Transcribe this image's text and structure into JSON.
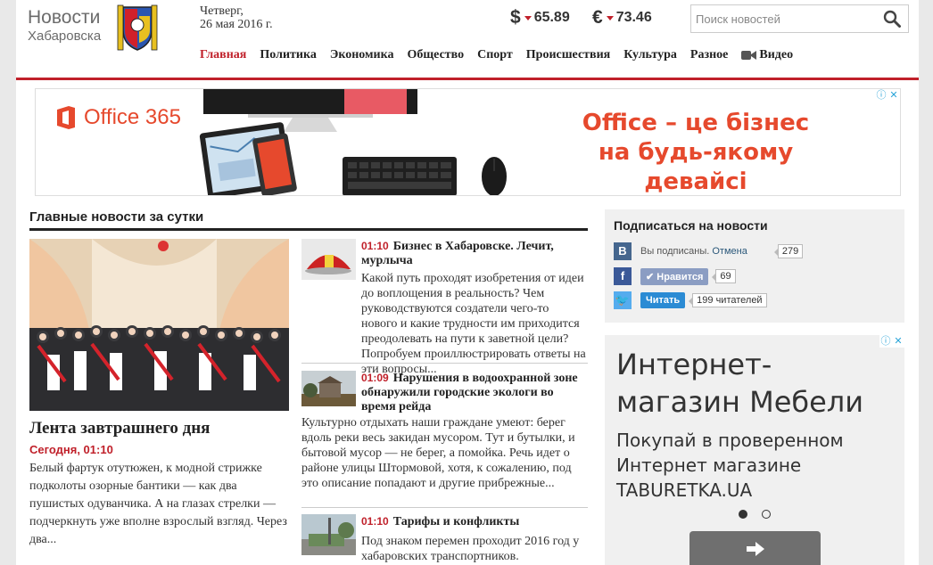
{
  "site": {
    "logo_line1": "Новости",
    "logo_line2": "Хабаровска",
    "date_line1": "Четверг,",
    "date_line2": "26 мая 2016 г."
  },
  "rates": {
    "usd_symbol": "$",
    "usd_value": "65.89",
    "eur_symbol": "€",
    "eur_value": "73.46",
    "trend_color": "#c0202a"
  },
  "search": {
    "placeholder": "Поиск новостей",
    "value": ""
  },
  "nav": {
    "items": [
      "Главная",
      "Политика",
      "Экономика",
      "Общество",
      "Спорт",
      "Происшествия",
      "Культура",
      "Разное",
      "Видео"
    ],
    "active_index": 0
  },
  "ad_top": {
    "brand": "Office 365",
    "slogan_line1": "Office – це бізнес",
    "slogan_line2": "на будь-якому девайсі"
  },
  "main": {
    "section_title": "Главные новости за сутки",
    "title": "Лента завтрашнего дня",
    "time": "Сегодня, 01:10",
    "lead": "Белый фартук отутюжен, к модной стрижке подколоты озорные бантики — как два пушистых одуванчика. А на глазах стрелки — подчеркнуть уже вполне взрослый взгляд. Через два..."
  },
  "news": [
    {
      "time": "01:10",
      "title": "Бизнес в Хабаровске. Лечит, мурлыча",
      "text": "Какой путь проходят изобретения от идеи до воплощения в реальность? Чем руководствуются создатели чего-то нового и какие трудности им приходится преодолевать на пути к заветной цели? Попробуем проиллюстрировать ответы на эти вопросы..."
    },
    {
      "time": "01:09",
      "title": "Нарушения в водоохранной зоне обнаружили городские экологи во время рейда",
      "text": "Культурно отдыхать наши граждане умеют: берег вдоль реки весь закидан мусором.  Тут и бутылки, и бытовой мусор — не берег, а помойка. Речь идет о районе улицы Штормовой, хотя, к сожалению, под это описание попадают и другие прибрежные..."
    },
    {
      "time": "01:10",
      "title": "Тарифы и конфликты",
      "text": "Под знаком перемен проходит 2016 год у хабаровских транспортников."
    }
  ],
  "subscribe": {
    "title": "Подписаться на новости",
    "vk_status": "Вы подписаны.",
    "vk_cancel": "Отмена",
    "vk_count": "279",
    "fb_button": "Нравится",
    "fb_count": "69",
    "tw_button": "Читать",
    "tw_count": "199 читателей"
  },
  "ad_side": {
    "headline": "Интернет-магазин Мебели",
    "text": "Покупай в проверенном Интернет магазине TABURETKA.UA"
  }
}
